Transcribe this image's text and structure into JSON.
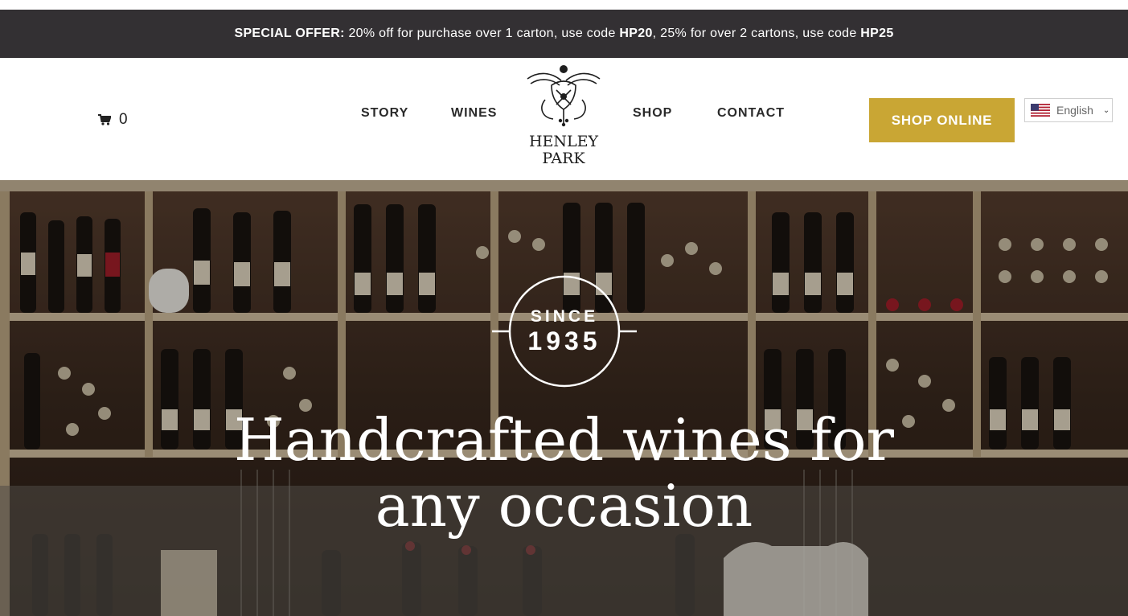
{
  "offer": {
    "label": "SPECIAL OFFER:",
    "text1": " 20% off for purchase over 1 carton, use code ",
    "code1": "HP20",
    "text2": ", 25% for over 2 cartons, use code ",
    "code2": "HP25"
  },
  "header": {
    "cart_count": "0",
    "nav": [
      "STORY",
      "WINES",
      "SHOP",
      "CONTACT"
    ],
    "logo_text": [
      "HENLEY",
      "PARK"
    ],
    "shop_online": "SHOP ONLINE",
    "language": "English"
  },
  "hero": {
    "badge_since": "SINCE",
    "badge_year": "1935",
    "headline_line1": "Handcrafted wines for",
    "headline_line2": "any occasion"
  },
  "colors": {
    "offer_bar": "#333033",
    "accent_gold": "#c9a634",
    "nav_text": "#2a2a2a"
  }
}
